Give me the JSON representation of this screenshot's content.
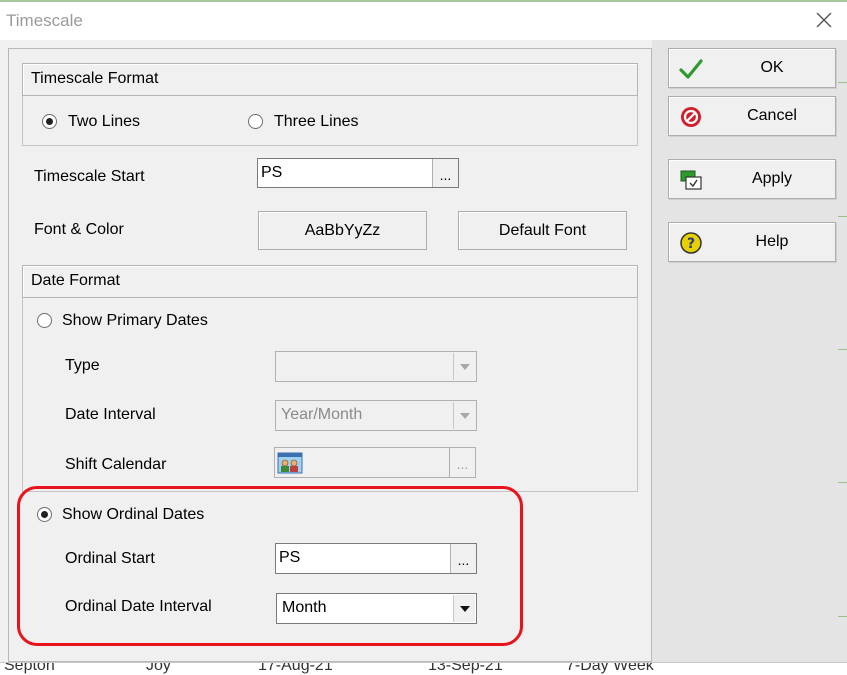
{
  "window": {
    "title": "Timescale"
  },
  "timescale_format": {
    "header": "Timescale Format",
    "two_lines": {
      "label": "Two Lines",
      "checked": true
    },
    "three_lines": {
      "label": "Three Lines",
      "checked": false
    }
  },
  "timescale_start": {
    "label": "Timescale Start",
    "value": "PS",
    "browse": "..."
  },
  "font_color": {
    "label": "Font & Color",
    "sample_button": "AaBbYyZz",
    "default_button": "Default Font"
  },
  "date_format": {
    "header": "Date Format",
    "show_primary": {
      "label": "Show Primary Dates",
      "checked": false
    },
    "type": {
      "label": "Type",
      "value": ""
    },
    "date_interval": {
      "label": "Date Interval",
      "value": "Year/Month"
    },
    "shift_calendar": {
      "label": "Shift Calendar",
      "browse": "..."
    },
    "show_ordinal": {
      "label": "Show Ordinal Dates",
      "checked": true
    },
    "ordinal_start": {
      "label": "Ordinal Start",
      "value": "PS",
      "browse": "..."
    },
    "ordinal_interval": {
      "label": "Ordinal Date Interval",
      "value": "Month"
    }
  },
  "actions": {
    "ok": "OK",
    "cancel": "Cancel",
    "apply": "Apply",
    "help": "Help"
  },
  "background_row": [
    "Septon",
    "Joy",
    "17-Aug-21",
    "13-Sep-21",
    "7-Day Week"
  ],
  "colors": {
    "highlight": "#e8141c",
    "check": "#2e9a2e",
    "cancel": "#d0202a",
    "help": "#e6d000"
  }
}
